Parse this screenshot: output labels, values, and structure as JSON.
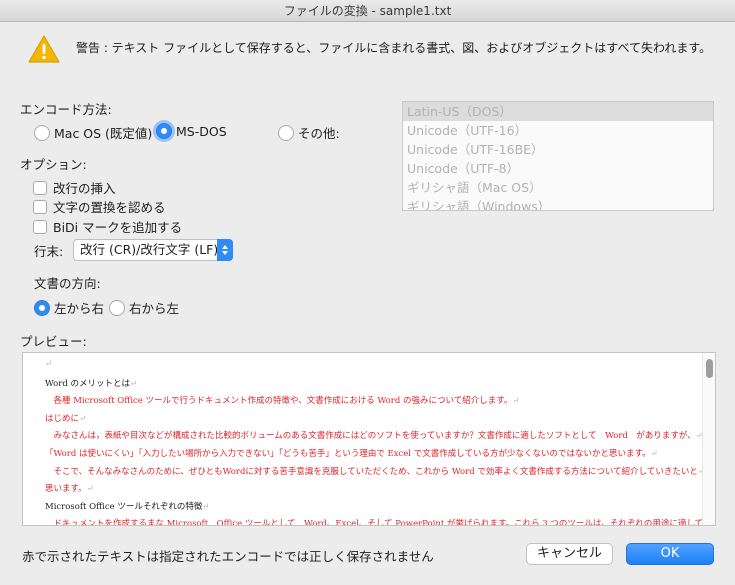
{
  "window": {
    "title": "ファイルの変換 - sample1.txt"
  },
  "warning": {
    "icon": "warning-icon",
    "text": "警告 : テキスト ファイルとして保存すると、ファイルに含まれる書式、図、およびオブジェクトはすべて失われます。"
  },
  "encoding": {
    "label": "エンコード方法:",
    "options": [
      "Mac OS (既定値)",
      "MS-DOS",
      "その他:"
    ],
    "selected": "MS-DOS",
    "list": [
      "Latin-US（DOS）",
      "Unicode（UTF-16）",
      "Unicode（UTF-16BE）",
      "Unicode（UTF-8）",
      "ギリシャ語（Mac OS）",
      "ギリシャ語（Windows）"
    ],
    "list_selected": "Latin-US（DOS）"
  },
  "options": {
    "label": "オプション:",
    "checkboxes": [
      "改行の挿入",
      "文字の置換を認める",
      "BiDi マークを追加する"
    ],
    "line_end_label": "行末:",
    "line_end_value": "改行 (CR)/改行文字 (LF)"
  },
  "direction": {
    "label": "文書の方向:",
    "options": [
      "左から右",
      "右から左"
    ],
    "selected": "左から右"
  },
  "preview": {
    "label": "プレビュー:",
    "mark": "↵",
    "lines": [
      {
        "text": "",
        "color": "black"
      },
      {
        "text": "Word のメリットとは",
        "color": "black"
      },
      {
        "text": "　各種 Microsoft Office ツールで行うドキュメント作成の特徴や、文書作成における Word の強みについて紹介します。",
        "color": "red"
      },
      {
        "text": "はじめに",
        "color": "red"
      },
      {
        "text": "　みなさんは，表紙や目次などが構成された比較的ボリュームのある文書作成にはどのソフトを使っていますか？文書作成に適したソフトとして　Word　がありますが、",
        "color": "red"
      },
      {
        "text": "「Word は使いにくい」「入力したい場所から入力できない」「どうも苦手」という理由で Excel で文書作成している方が少なくないのではないかと思います。",
        "color": "red"
      },
      {
        "text": "　そこで、そんなみなさんのために、ぜひともWordに対する苦手意識を克服していただくため、これから Word で効率よく文書作成する方法について紹介していきたいと",
        "color": "red"
      },
      {
        "text": "思います。",
        "color": "red"
      },
      {
        "text": "Microsoft Office ツールそれぞれの特徴",
        "color": "black"
      },
      {
        "text": "　ドキュメントを作成するまな Microsoft　Office ツールとして　Word、Excel、そして PowerPoint が挙げられます。これら 3 つのツールは、それぞれの用途に適して作ら",
        "color": "red"
      }
    ]
  },
  "footer": {
    "note": "赤で示されたテキストは指定されたエンコードでは正しく保存されません",
    "cancel_label": "キャンセル",
    "ok_label": "OK"
  },
  "colors": {
    "accent": "#2f8cf6",
    "error_text": "#e0222a",
    "warning": "#f2b705"
  }
}
